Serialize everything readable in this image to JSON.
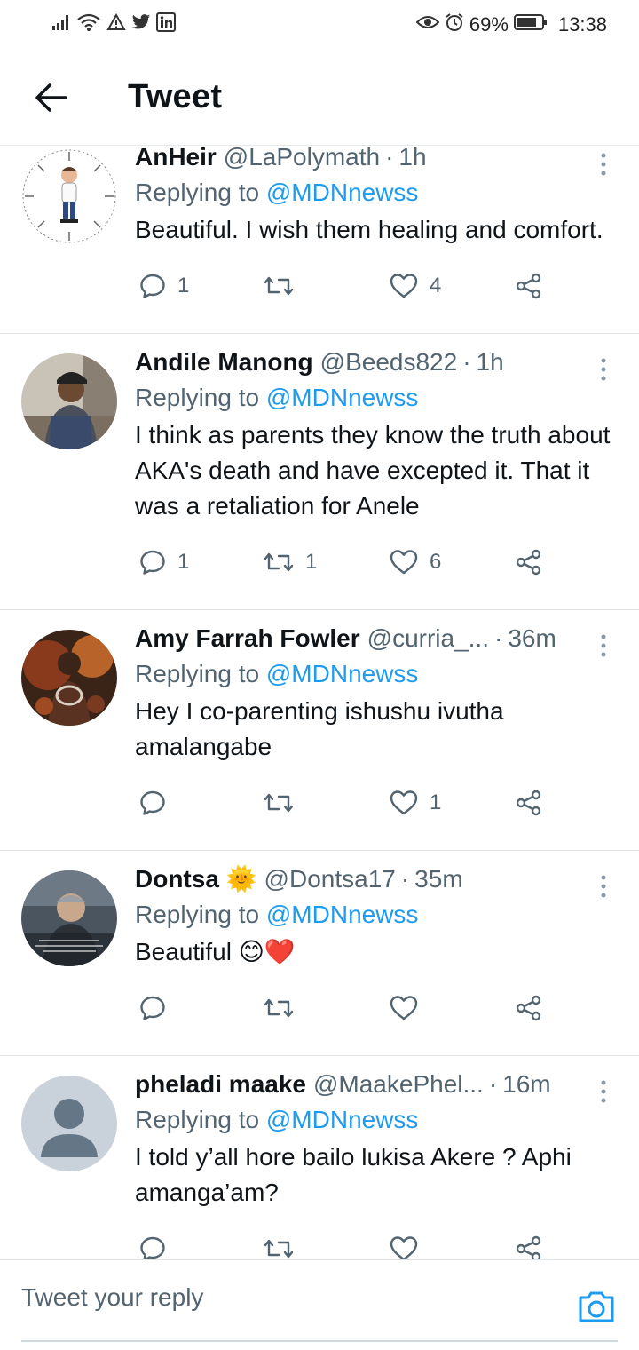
{
  "status_bar": {
    "battery": "69%",
    "time": "13:38",
    "icons_left": [
      "signal-icon",
      "wifi-icon",
      "warning-icon",
      "twitter-bird-icon",
      "linkedin-icon"
    ],
    "icons_right": [
      "eye-icon",
      "alarm-icon",
      "battery-icon"
    ]
  },
  "header": {
    "title": "Tweet"
  },
  "replying_prefix": "Replying to",
  "tweets": [
    {
      "name": "AnHeir",
      "handle": "@LaPolymath",
      "time": "1h",
      "mention": "@MDNnewss",
      "text": "Beautiful. I wish them healing and comfort.",
      "replies": "1",
      "retweets": "",
      "likes": "4"
    },
    {
      "name": "Andile Manong",
      "handle": "@Beeds822",
      "time": "1h",
      "mention": "@MDNnewss",
      "text": "I think as parents they know the truth about AKA's death and have excepted it. That it was a retaliation for Anele",
      "replies": "1",
      "retweets": "1",
      "likes": "6"
    },
    {
      "name": "Amy Farrah Fowler",
      "handle": "@curria_...",
      "time": "36m",
      "mention": "@MDNnewss",
      "text": "Hey I co-parenting ishushu ivutha amalangabe",
      "replies": "",
      "retweets": "",
      "likes": "1"
    },
    {
      "name": "Dontsa 🌞",
      "handle": "@Dontsa17",
      "time": "35m",
      "mention": "@MDNnewss",
      "text": "Beautiful 😊❤️",
      "replies": "",
      "retweets": "",
      "likes": ""
    },
    {
      "name": "pheladi maake",
      "handle": "@MaakePhel...",
      "time": "16m",
      "mention": "@MDNnewss",
      "text": "I told y’all hore bailo lukisa Akere ? Aphi amanga’am?",
      "replies": "",
      "retweets": "",
      "likes": ""
    }
  ],
  "composer": {
    "placeholder": "Tweet your reply"
  },
  "colors": {
    "accent": "#1d9bf0",
    "text": "#0f1419",
    "muted": "#536471",
    "divider": "#dfe3e6"
  }
}
